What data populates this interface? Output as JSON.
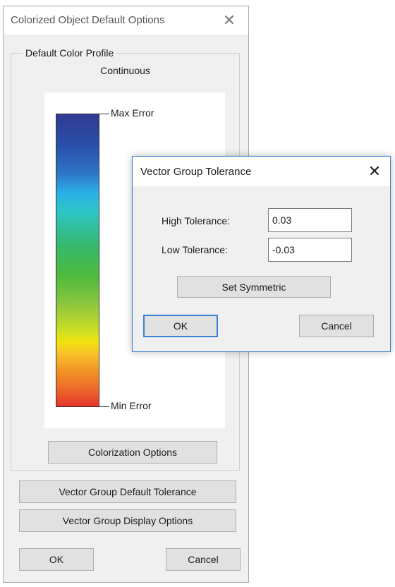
{
  "main_window": {
    "title": "Colorized Object Default Options",
    "close_glyph": "✕",
    "group_title": "Default Color Profile",
    "profile_mode": "Continuous",
    "color_scale": {
      "max_label": "Max Error",
      "min_label": "Min Error"
    },
    "buttons": {
      "colorization_options": "Colorization Options",
      "vector_group_default_tolerance": "Vector Group Default Tolerance",
      "vector_group_display_options": "Vector Group Display Options",
      "ok": "OK",
      "cancel": "Cancel"
    }
  },
  "tolerance_dialog": {
    "title": "Vector Group Tolerance",
    "close_glyph": "✕",
    "high_label": "High Tolerance:",
    "high_value": "0.03",
    "low_label": "Low Tolerance:",
    "low_value": "-0.03",
    "set_symmetric": "Set Symmetric",
    "ok": "OK",
    "cancel": "Cancel"
  },
  "colors": {
    "window_bg": "#f0f0f0",
    "button_bg": "#e1e1e1",
    "accent_focus": "#3c7fd6",
    "gradient_top": "#303a91",
    "gradient_bottom": "#e5332a"
  },
  "icons": {
    "close": "close-icon"
  }
}
